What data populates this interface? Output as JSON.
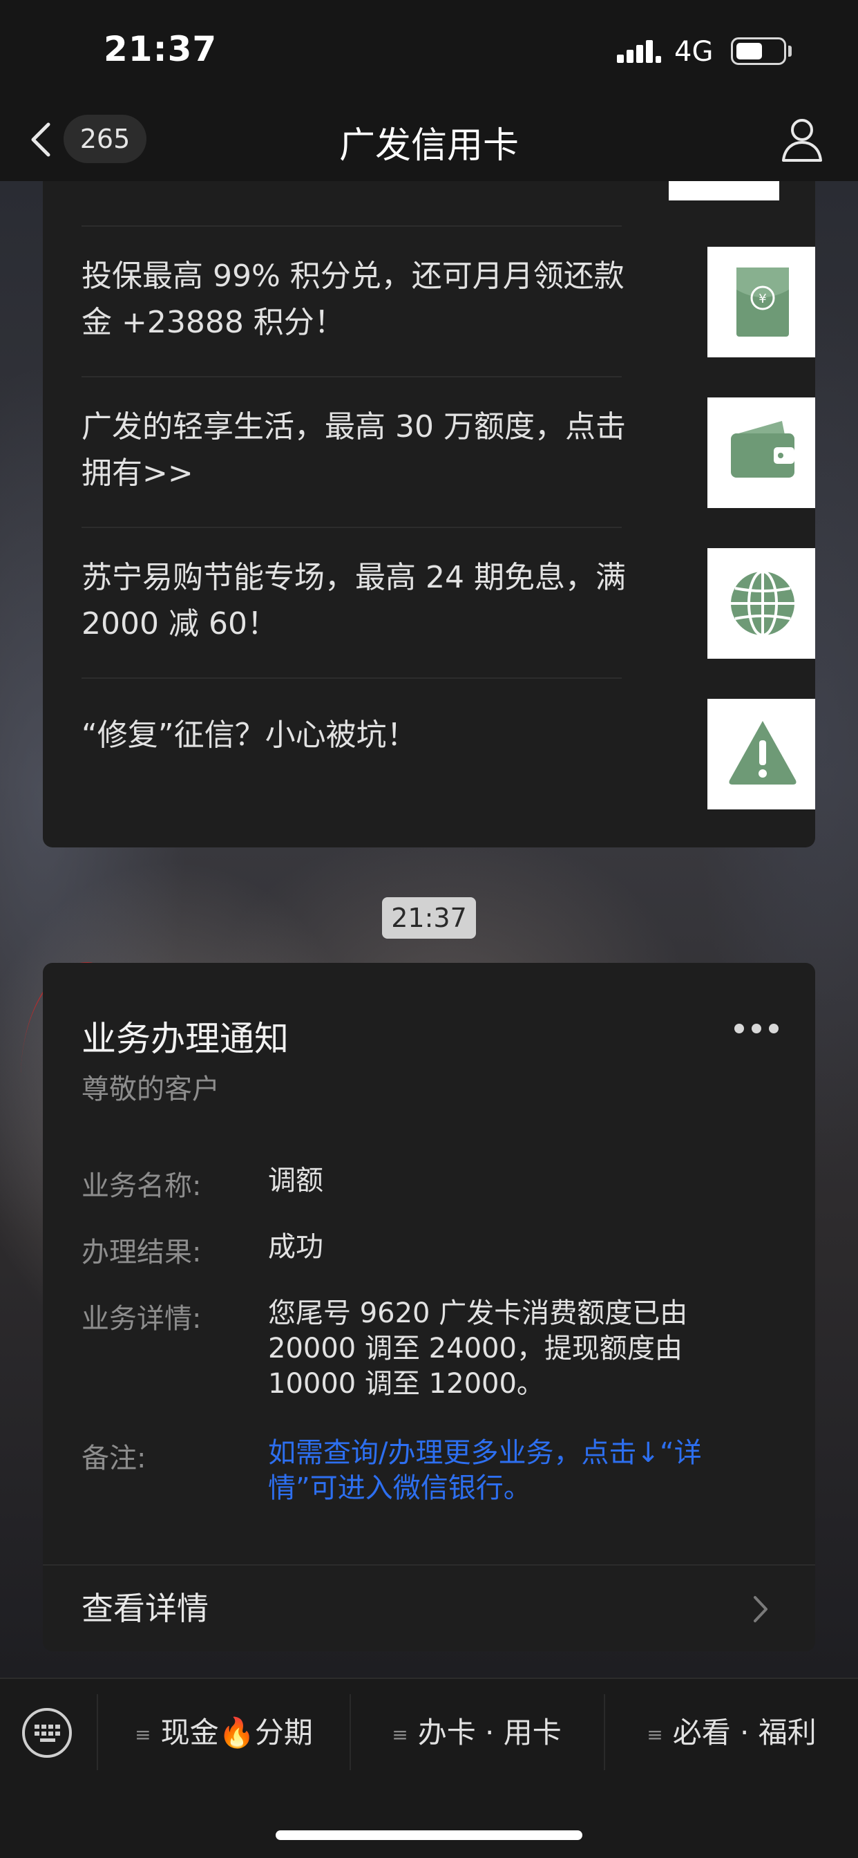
{
  "status_bar": {
    "time": "21:37",
    "network": "4G",
    "battery_level": 0.55
  },
  "nav": {
    "back_count": "265",
    "title": "广发信用卡"
  },
  "articles": [
    {
      "text": "投保最高 99% 积分兑，还可月月领还款金 +23888 积分！",
      "icon": "red-envelope-icon"
    },
    {
      "text": "广发的轻享生活，最高 30 万额度，点击拥有>>",
      "icon": "wallet-icon"
    },
    {
      "text": "苏宁易购节能专场，最高 24 期免息，满 2000 减 60！",
      "icon": "globe-icon"
    },
    {
      "text": "“修复”征信？小心被坑！",
      "icon": "warning-icon"
    }
  ],
  "timestamp": "21:37",
  "notice": {
    "title": "业务办理通知",
    "subtitle": "尊敬的客户",
    "fields": [
      {
        "label": "业务名称:",
        "value": "调额"
      },
      {
        "label": "办理结果:",
        "value": "成功"
      },
      {
        "label": "业务详情:",
        "value": "您尾号 9620 广发卡消费额度已由 20000 调至 24000，提现额度由 10000 调至 12000。"
      },
      {
        "label": "备注:",
        "value": "如需查询/办理更多业务，点击↓“详情”可进入微信银行。"
      }
    ],
    "details_label": "查看详情"
  },
  "menu": {
    "items": [
      {
        "label_before": "现金",
        "emoji": "🔥",
        "label_after": "分期"
      },
      {
        "label": "办卡 · 用卡"
      },
      {
        "label": "必看 · 福利"
      }
    ]
  },
  "colors": {
    "icon_green": "#6e9a76",
    "link_blue": "#2d6ff0",
    "card_bg": "#1e1e1e"
  }
}
